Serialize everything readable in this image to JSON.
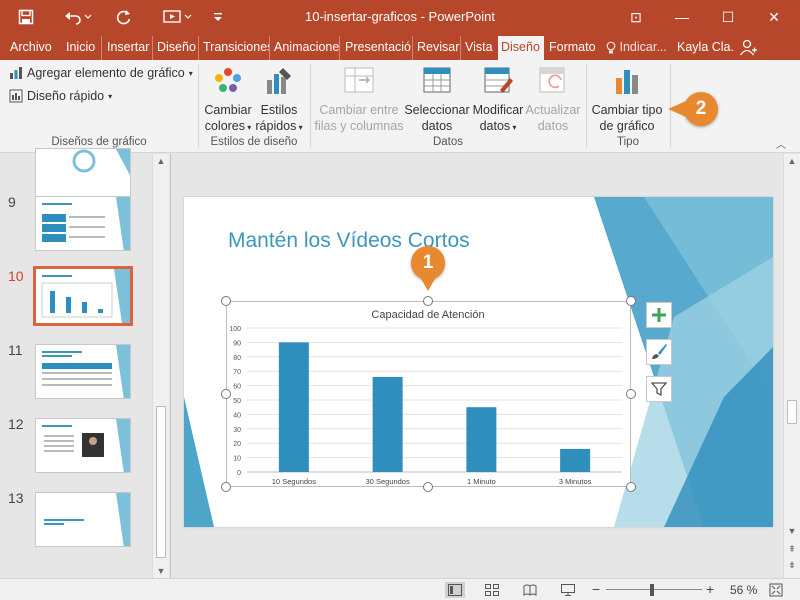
{
  "titlebar": {
    "title": "10-insertar-graficos  -  PowerPoint",
    "minimize": "—",
    "maximize": "☐",
    "close": "✕",
    "ribbon_display": "⊡",
    "restore": "⧉"
  },
  "tabs": {
    "archivo": "Archivo",
    "inicio": "Inicio",
    "insertar": "Insertar",
    "diseno": "Diseño",
    "transiciones": "Transiciones",
    "animaciones": "Animaciones",
    "presentacion": "Presentació",
    "revisar": "Revisar",
    "vista": "Vista",
    "diseno_chart": "Diseño",
    "formato": "Formato",
    "tell_me": "Indicar...",
    "user": "Kayla Cla..."
  },
  "ribbon": {
    "add_chart_element": "Agregar elemento de gráfico",
    "quick_layout": "Diseño rápido",
    "change_colors_1": "Cambiar",
    "change_colors_2": "colores",
    "quick_styles_1": "Estilos",
    "quick_styles_2": "rápidos",
    "switch_row_col_1": "Cambiar entre",
    "switch_row_col_2": "filas y columnas",
    "select_data_1": "Seleccionar",
    "select_data_2": "datos",
    "edit_data_1": "Modificar",
    "edit_data_2": "datos",
    "refresh_data_1": "Actualizar",
    "refresh_data_2": "datos",
    "change_type_1": "Cambiar tipo",
    "change_type_2": "de gráfico",
    "group_layouts": "Diseños de gráfico",
    "group_styles": "Estilos de diseño",
    "group_data": "Datos",
    "group_type": "Tipo"
  },
  "callouts": {
    "one": "1",
    "two": "2"
  },
  "slides_panel": {
    "numbers": [
      "9",
      "10",
      "11",
      "12",
      "13"
    ]
  },
  "slide": {
    "title": "Mantén los Vídeos Cortos"
  },
  "chart_data": {
    "type": "bar",
    "title": "Capacidad de Atención",
    "categories": [
      "10 Segundos",
      "30 Segundos",
      "1 Minuto",
      "3 Minutos"
    ],
    "values": [
      90,
      66,
      45,
      16
    ],
    "ylim": [
      0,
      100
    ],
    "yticks": [
      "0",
      "10",
      "20",
      "30",
      "40",
      "50",
      "60",
      "70",
      "80",
      "90",
      "100"
    ],
    "color": "#2e8fbd",
    "grid": true
  },
  "statusbar": {
    "zoom": "56 %",
    "minus": "−",
    "plus": "+"
  },
  "colors": {
    "accent": "#b7472a",
    "callout": "#e8882f",
    "title_blue": "#3d97b9"
  }
}
